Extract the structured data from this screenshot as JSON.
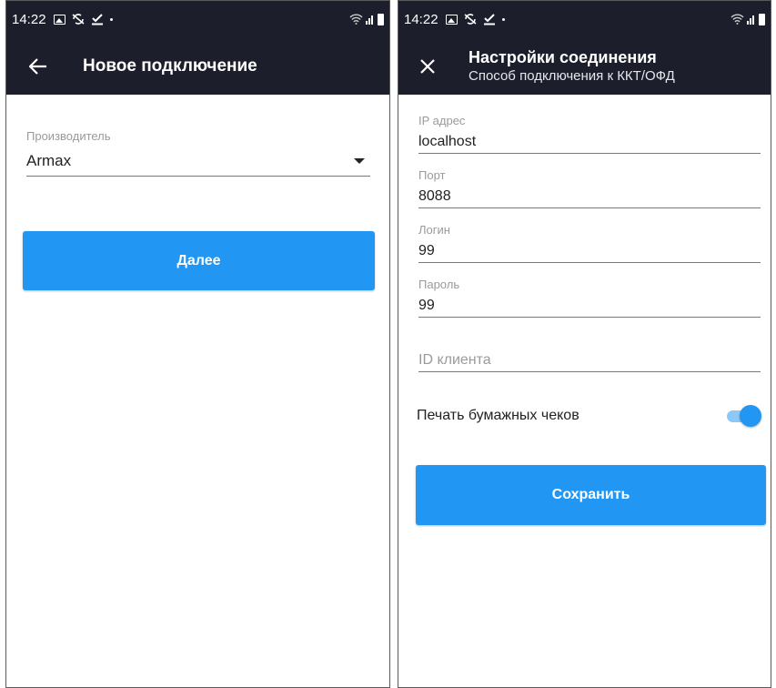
{
  "colors": {
    "appbar": "#1d1e2c",
    "accent": "#2196f3",
    "toggle_track": "#8ec8f7"
  },
  "left_screen": {
    "status_bar": {
      "time": "14:22",
      "icons": [
        "image-icon",
        "sync-off-icon",
        "download-done-icon",
        "dot-icon"
      ],
      "right_icons": [
        "wifi-icon",
        "signal-icon",
        "battery-icon"
      ]
    },
    "app_bar": {
      "nav_icon": "arrow-back-icon",
      "title": "Новое подключение"
    },
    "manufacturer": {
      "label": "Производитель",
      "value": "Armax"
    },
    "next_button": "Далее"
  },
  "right_screen": {
    "status_bar": {
      "time": "14:22",
      "icons": [
        "image-icon",
        "sync-off-icon",
        "download-done-icon",
        "dot-icon"
      ],
      "right_icons": [
        "wifi-icon",
        "signal-icon",
        "battery-icon"
      ]
    },
    "app_bar": {
      "nav_icon": "close-icon",
      "title": "Настройки соединения",
      "subtitle": "Способ подключения к ККТ/ОФД"
    },
    "fields": {
      "ip": {
        "label": "IP адрес",
        "value": "localhost"
      },
      "port": {
        "label": "Порт",
        "value": "8088"
      },
      "login": {
        "label": "Логин",
        "value": "99"
      },
      "password": {
        "label": "Пароль",
        "value": "99"
      },
      "client_id": {
        "placeholder": "ID клиента",
        "value": ""
      }
    },
    "paper_receipts": {
      "label": "Печать бумажных чеков",
      "enabled": true
    },
    "save_button": "Сохранить"
  }
}
